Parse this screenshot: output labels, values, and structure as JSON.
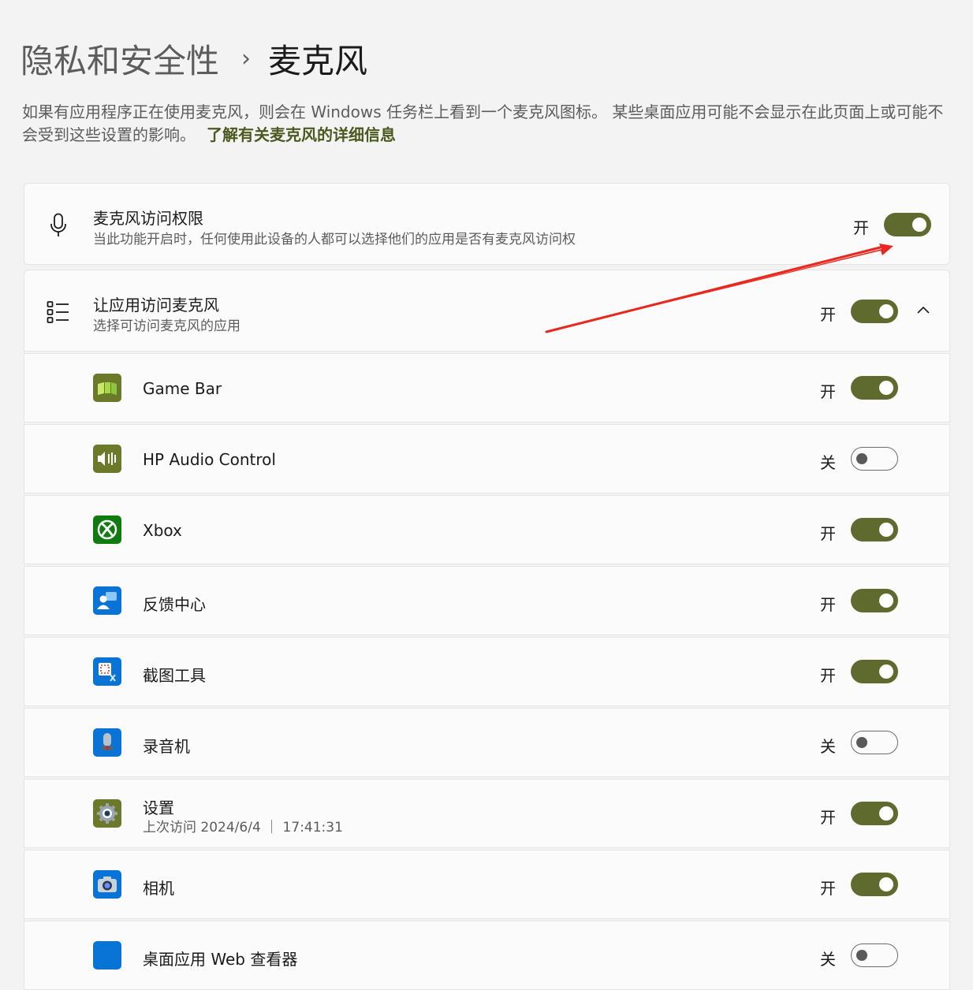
{
  "header": {
    "parent": "隐私和安全性",
    "separator": "›",
    "current": "麦克风"
  },
  "description": {
    "text": "如果有应用程序正在使用麦克风，则会在 Windows 任务栏上看到一个麦克风图标。 某些桌面应用可能不会显示在此页面上或可能不会受到这些设置的影响。",
    "link": "了解有关麦克风的详细信息"
  },
  "mic_access": {
    "icon": "microphone-icon",
    "title": "麦克风访问权限",
    "subtitle": "当此功能开启时，任何使用此设备的人都可以选择他们的应用是否有麦克风访问权",
    "state_label": "开",
    "on": true
  },
  "app_access": {
    "icon": "app-list-icon",
    "title": "让应用访问麦克风",
    "subtitle": "选择可访问麦克风的应用",
    "state_label": "开",
    "on": true,
    "expanded": true
  },
  "apps": [
    {
      "name": "Game Bar",
      "subtitle": "",
      "state_label": "开",
      "on": true,
      "icon": "game-bar-icon",
      "color": "#6b7a2a"
    },
    {
      "name": "HP Audio Control",
      "subtitle": "",
      "state_label": "关",
      "on": false,
      "icon": "hp-audio-icon",
      "color": "#6b7a2a"
    },
    {
      "name": "Xbox",
      "subtitle": "",
      "state_label": "开",
      "on": true,
      "icon": "xbox-icon",
      "color": "#107c10"
    },
    {
      "name": "反馈中心",
      "subtitle": "",
      "state_label": "开",
      "on": true,
      "icon": "feedback-hub-icon",
      "color": "#0a74d6"
    },
    {
      "name": "截图工具",
      "subtitle": "",
      "state_label": "开",
      "on": true,
      "icon": "snipping-tool-icon",
      "color": "#0a74d6"
    },
    {
      "name": "录音机",
      "subtitle": "",
      "state_label": "关",
      "on": false,
      "icon": "voice-recorder-icon",
      "color": "#0a74d6"
    },
    {
      "name": "设置",
      "subtitle": "上次访问 2024/6/4 ｜ 17:41:31",
      "state_label": "开",
      "on": true,
      "icon": "settings-gear-icon",
      "color": "#6b7a2a"
    },
    {
      "name": "相机",
      "subtitle": "",
      "state_label": "开",
      "on": true,
      "icon": "camera-icon",
      "color": "#0a74d6"
    },
    {
      "name": "桌面应用 Web 查看器",
      "subtitle": "",
      "state_label": "关",
      "on": false,
      "icon": "web-viewer-icon",
      "color": "#0a74d6"
    }
  ],
  "colors": {
    "accent": "#5f6a2e",
    "link": "#4a5a1e",
    "annotation_arrow": "#e8281e"
  }
}
